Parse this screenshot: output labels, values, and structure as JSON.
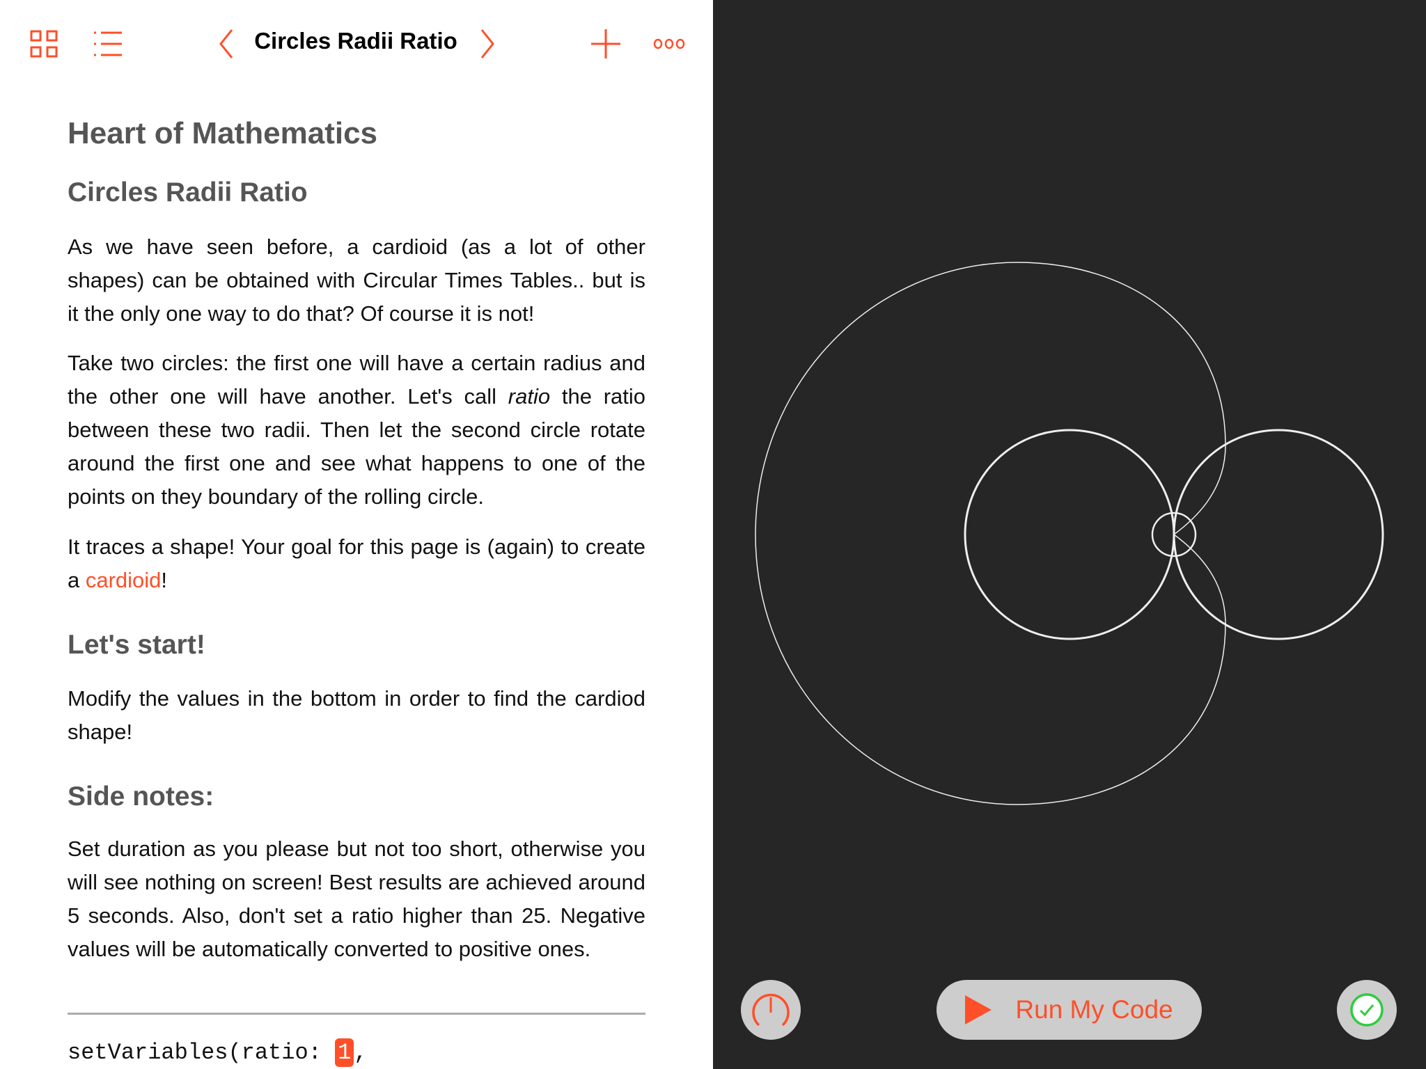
{
  "toolbar": {
    "title": "Circles Radii Ratio",
    "icons": [
      "grid-icon",
      "list-icon",
      "chevron-left-icon",
      "chevron-right-icon",
      "plus-icon",
      "more-icon"
    ],
    "accent": "#ff4f28"
  },
  "content": {
    "h1": "Heart of Mathematics",
    "h2": "Circles Radii Ratio",
    "p1": "As we have seen before, a cardioid (as a lot of other shapes) can be obtained with Circular Times Tables.. but is it the only one way to do that? Of course it is not!",
    "p2a": "Take two circles: the first one will have a certain radius and the other one will have another. Let's call ",
    "p2i": "ratio",
    "p2b": " the ratio between these two radii. Then let the second circle rotate around the first one and see what happens to one of the points on they boundary of the rolling circle.",
    "p3a": "It traces a shape! Your goal for this page is (again) to create a ",
    "p3link": "cardioid",
    "p3b": "!",
    "h_start": "Let's start!",
    "p4": "Modify the values in the bottom in order to find the cardiod shape!",
    "h_notes": "Side notes:",
    "p5": "Set duration as you please but not too short, otherwise you will see nothing on screen! Best results are achieved around 5 seconds. Also, don't set a ratio higher than 25. Negative values will be automatically converted to positive ones.",
    "code_prefix": "setVariables(ratio: ",
    "code_value": "1",
    "code_suffix": ","
  },
  "live_view": {
    "run_label": "Run My Code",
    "background": "#262626"
  }
}
